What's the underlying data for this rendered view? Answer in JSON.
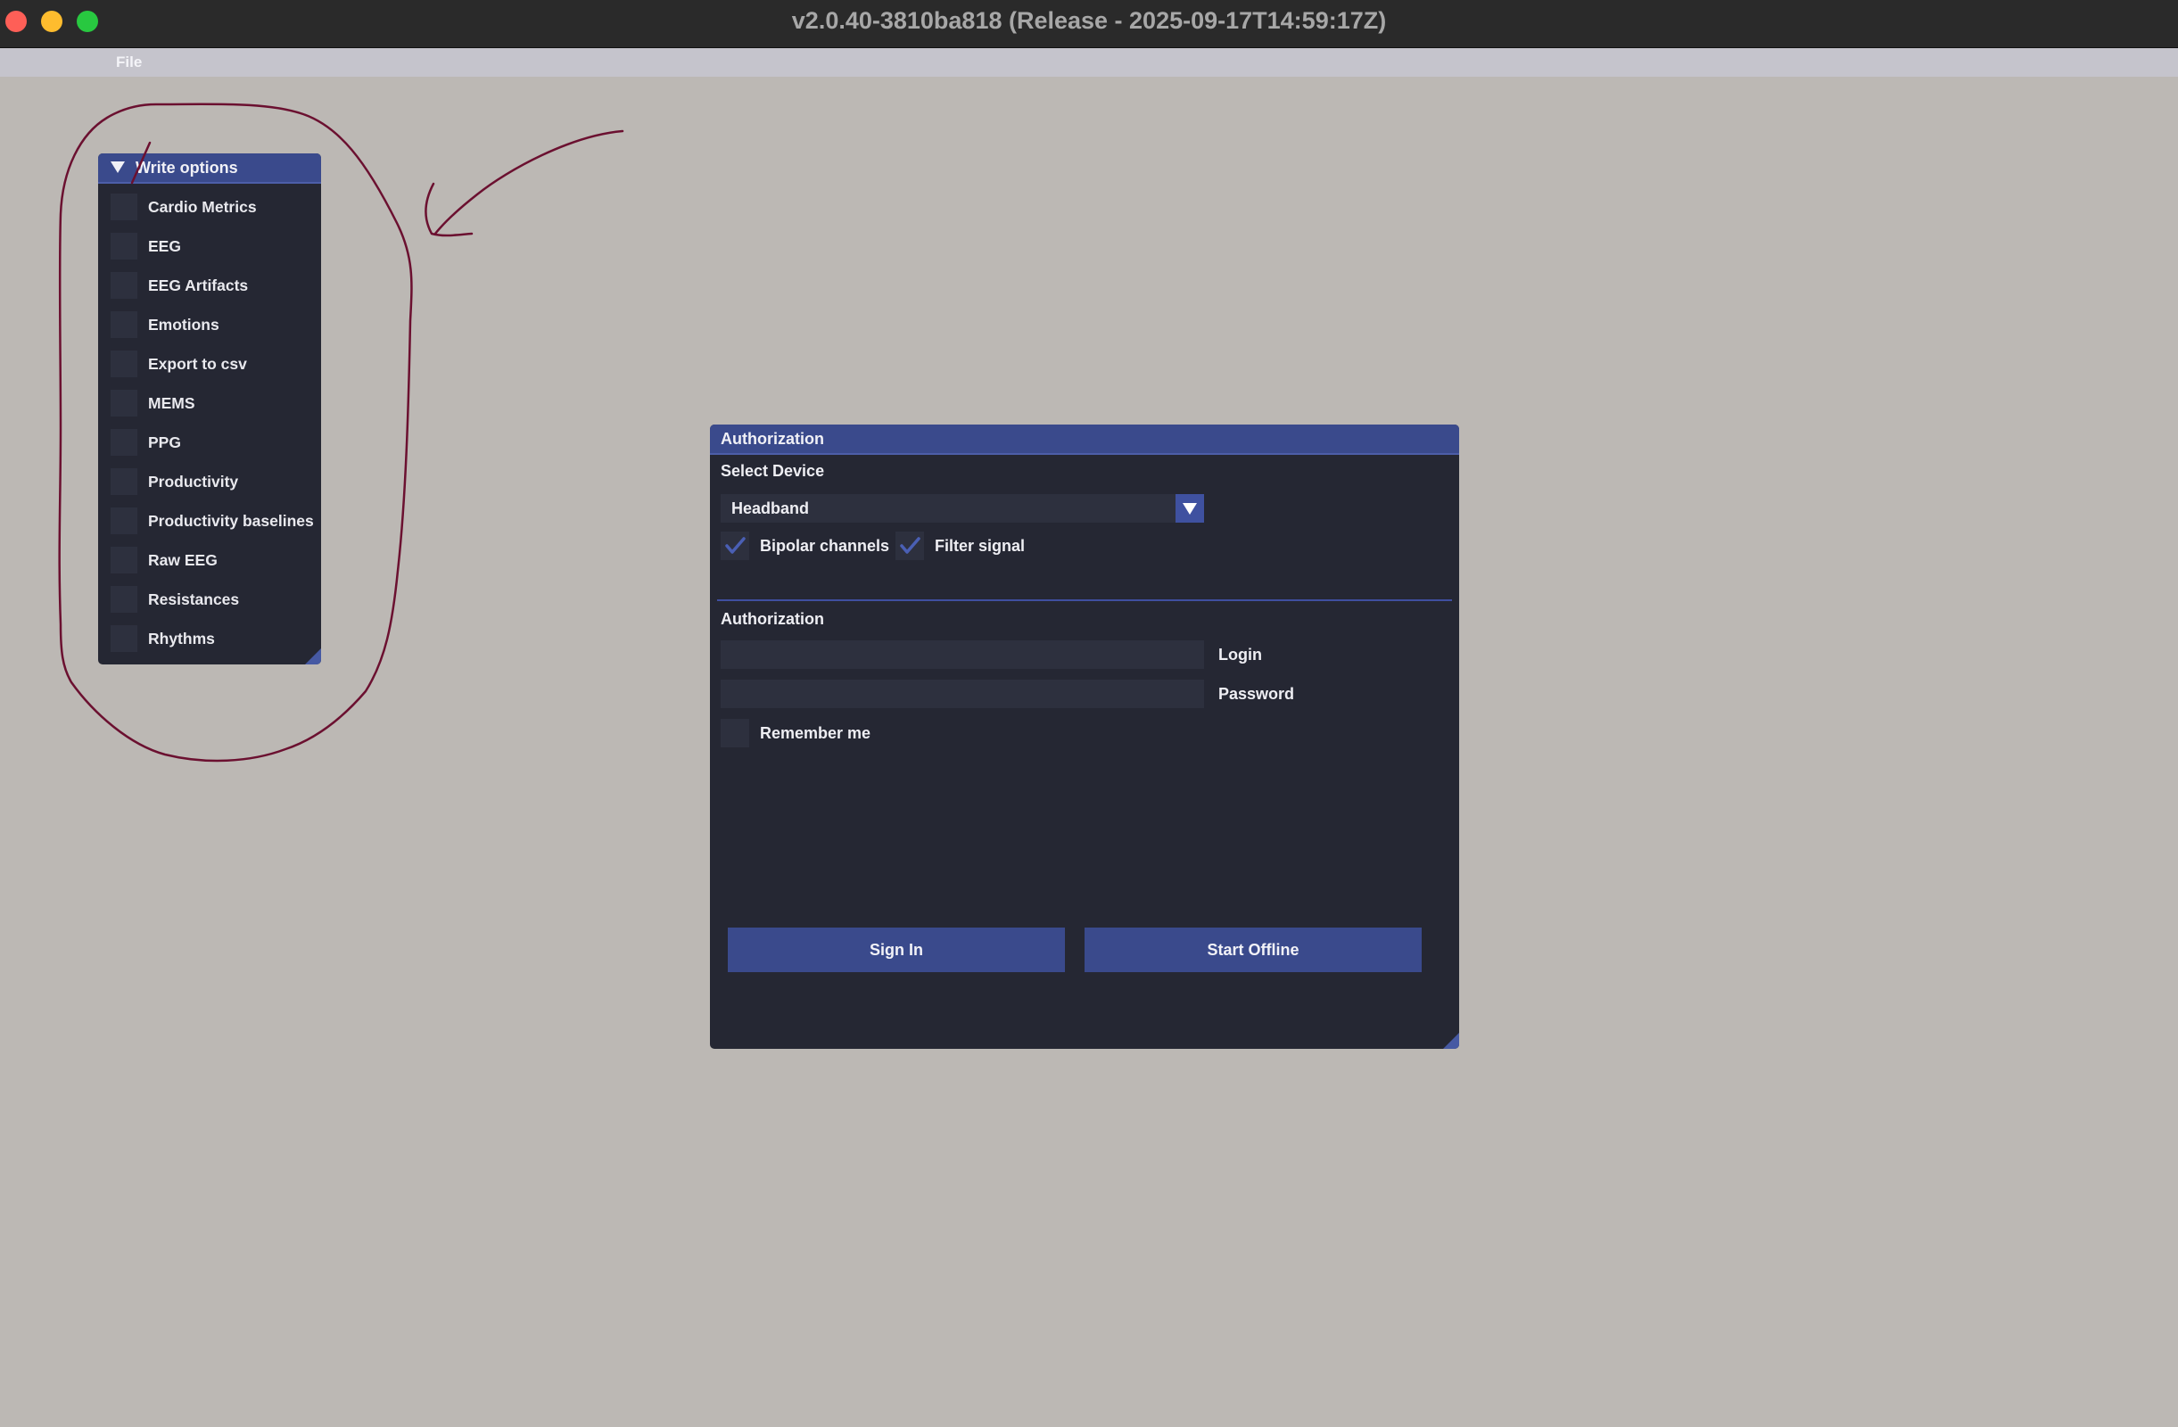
{
  "window": {
    "title": "v2.0.40-3810ba818 (Release - 2025-09-17T14:59:17Z)"
  },
  "menu": {
    "file": "File"
  },
  "write_options": {
    "title": "Write options",
    "items": [
      {
        "label": "Cardio Metrics",
        "checked": false
      },
      {
        "label": "EEG",
        "checked": false
      },
      {
        "label": "EEG Artifacts",
        "checked": false
      },
      {
        "label": "Emotions",
        "checked": false
      },
      {
        "label": "Export to csv",
        "checked": false
      },
      {
        "label": "MEMS",
        "checked": false
      },
      {
        "label": "PPG",
        "checked": false
      },
      {
        "label": "Productivity",
        "checked": false
      },
      {
        "label": "Productivity baselines",
        "checked": false
      },
      {
        "label": "Raw EEG",
        "checked": false
      },
      {
        "label": "Resistances",
        "checked": false
      },
      {
        "label": "Rhythms",
        "checked": false
      }
    ]
  },
  "auth": {
    "title": "Authorization",
    "select_device_label": "Select Device",
    "device_value": "Headband",
    "bipolar_label": "Bipolar channels",
    "bipolar_checked": true,
    "filter_label": "Filter signal",
    "filter_checked": true,
    "section_label": "Authorization",
    "login_label": "Login",
    "login_value": "",
    "password_label": "Password",
    "password_value": "",
    "remember_label": "Remember me",
    "remember_checked": false,
    "sign_in_label": "Sign In",
    "start_offline_label": "Start Offline"
  },
  "colors": {
    "desktop": "#bcb8b4",
    "panel_bg": "#252733",
    "accent": "#3a4a8c",
    "annotation": "#6b1030"
  }
}
